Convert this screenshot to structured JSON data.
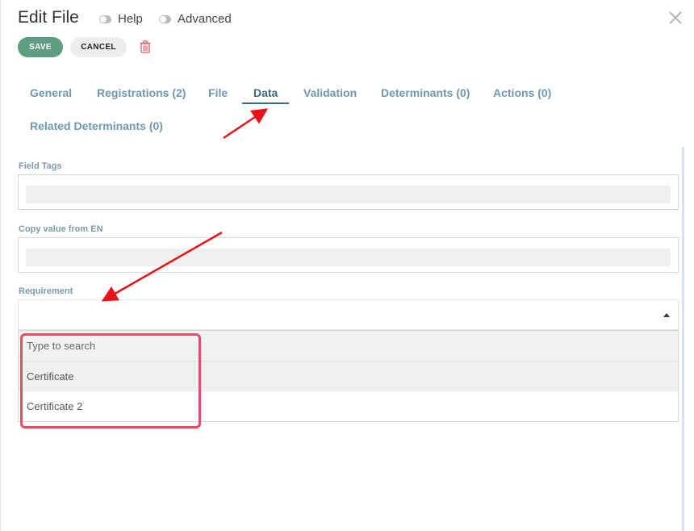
{
  "header": {
    "title": "Edit File",
    "help_label": "Help",
    "advanced_label": "Advanced"
  },
  "toolbar": {
    "save_label": "SAVE",
    "cancel_label": "CANCEL"
  },
  "tabs": [
    {
      "label": "General"
    },
    {
      "label": "Registrations (2)"
    },
    {
      "label": "File"
    },
    {
      "label": "Data",
      "active": true
    },
    {
      "label": "Validation"
    },
    {
      "label": "Determinants (0)"
    },
    {
      "label": "Actions (0)"
    },
    {
      "label": "Related Determinants (0)"
    }
  ],
  "form": {
    "field_tags_label": "Field Tags",
    "copy_value_label": "Copy value from EN",
    "requirement_label": "Requirement",
    "requirement_search_placeholder": "Type to search",
    "requirement_options": [
      {
        "label": "Certificate"
      },
      {
        "label": "Certificate 2"
      }
    ]
  },
  "colors": {
    "accent_save": "#5e9d80",
    "tab_color": "#6d98b4",
    "tab_active": "#3a6b8c",
    "annotation_red": "#e8121a",
    "highlight_pink": "#e84a6b",
    "trash_red": "#e05a6a"
  },
  "icons": {
    "close": "close-icon",
    "trash": "trash-icon",
    "caret": "caret-up-icon"
  }
}
